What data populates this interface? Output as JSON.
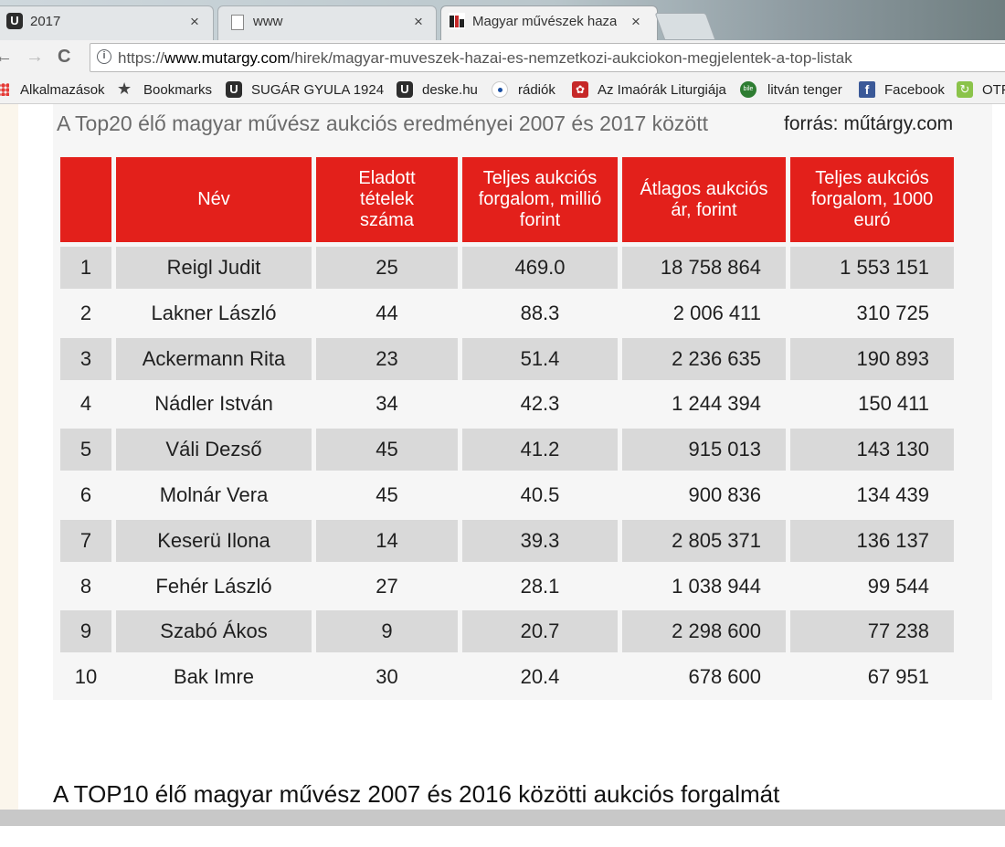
{
  "tabs": [
    {
      "label": "2017",
      "close": "×"
    },
    {
      "label": "www",
      "close": "×"
    },
    {
      "label": "Magyar művészek hazai",
      "close": "×"
    }
  ],
  "toolbar": {
    "back": "←",
    "forward": "→",
    "reload": "C",
    "url_scheme": "https://",
    "url_host": "www.mutargy.com",
    "url_path": "/hirek/magyar-muveszek-hazai-es-nemzetkozi-aukciokon-megjelentek-a-top-listak"
  },
  "bookmarks": [
    {
      "label": "Alkalmazások",
      "icon": "apps-icon"
    },
    {
      "label": "Bookmarks",
      "icon": "star-icon"
    },
    {
      "label": "SUGÁR GYULA  1924",
      "icon": "u-logo-icon"
    },
    {
      "label": "deske.hu",
      "icon": "u-logo-icon"
    },
    {
      "label": "rádiók",
      "icon": "radio-icon"
    },
    {
      "label": "Az Imaórák Liturgiája",
      "icon": "prayer-icon"
    },
    {
      "label": "litván tenger",
      "icon": "bile-icon"
    },
    {
      "label": "Facebook",
      "icon": "facebook-icon"
    },
    {
      "label": "OTP",
      "icon": "otp-icon"
    }
  ],
  "article": {
    "image_title": "A Top20 élő magyar művész aukciós eredményei 2007 és 2017 között",
    "image_source": "forrás: műtárgy.com",
    "heading": "A TOP10 élő magyar művész 2007 és 2016 közötti aukciós forgalmát"
  },
  "table": {
    "headers": [
      "",
      "Név",
      "Eladott tételek száma",
      "Teljes aukciós forgalom, millió forint",
      "Átlagos aukciós ár, forint",
      "Teljes aukciós forgalom, 1000 euró"
    ],
    "rows": [
      [
        "1",
        "Reigl Judit",
        "25",
        "469.0",
        "18 758 864",
        "1 553 151"
      ],
      [
        "2",
        "Lakner László",
        "44",
        "88.3",
        "2 006 411",
        "310 725"
      ],
      [
        "3",
        "Ackermann Rita",
        "23",
        "51.4",
        "2 236 635",
        "190 893"
      ],
      [
        "4",
        "Nádler István",
        "34",
        "42.3",
        "1 244 394",
        "150 411"
      ],
      [
        "5",
        "Váli Dezső",
        "45",
        "41.2",
        "915 013",
        "143 130"
      ],
      [
        "6",
        "Molnár Vera",
        "45",
        "40.5",
        "900 836",
        "134 439"
      ],
      [
        "7",
        "Keserü Ilona",
        "14",
        "39.3",
        "2 805 371",
        "136 137"
      ],
      [
        "8",
        "Fehér László",
        "27",
        "28.1",
        "1 038 944",
        "99 544"
      ],
      [
        "9",
        "Szabó Ákos",
        "9",
        "20.7",
        "2 298 600",
        "77 238"
      ],
      [
        "10",
        "Bak Imre",
        "30",
        "20.4",
        "678 600",
        "67 951"
      ]
    ]
  },
  "colors": {
    "header_red": "#e3201b",
    "row_shade": "#d9d9d9"
  }
}
